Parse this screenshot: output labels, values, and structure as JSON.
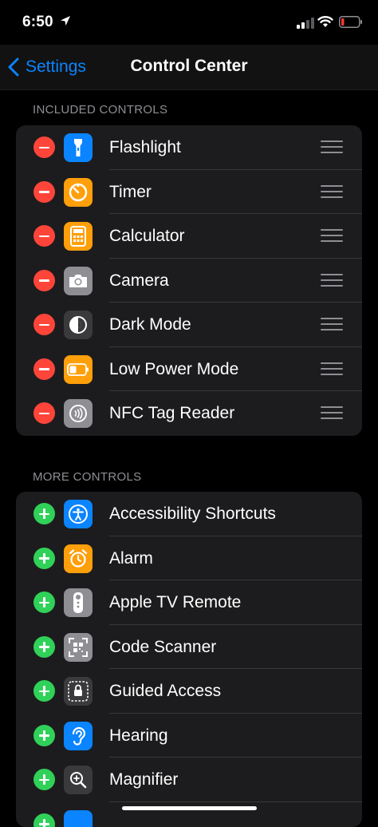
{
  "status_bar": {
    "time": "6:50",
    "battery_color": "#ff3b30"
  },
  "nav": {
    "back_label": "Settings",
    "title": "Control Center"
  },
  "colors": {
    "accent": "#0a84ff",
    "remove": "#ff453a",
    "add": "#30d158"
  },
  "included": {
    "header": "INCLUDED CONTROLS",
    "items": [
      {
        "label": "Flashlight",
        "icon": "flashlight-icon",
        "color": "#0a84ff"
      },
      {
        "label": "Timer",
        "icon": "timer-icon",
        "color": "#ff9f0a"
      },
      {
        "label": "Calculator",
        "icon": "calculator-icon",
        "color": "#ff9f0a"
      },
      {
        "label": "Camera",
        "icon": "camera-icon",
        "color": "#8e8e93"
      },
      {
        "label": "Dark Mode",
        "icon": "dark-mode-icon",
        "color": "#3a3a3c"
      },
      {
        "label": "Low Power Mode",
        "icon": "battery-icon",
        "color": "#ff9f0a"
      },
      {
        "label": "NFC Tag Reader",
        "icon": "nfc-icon",
        "color": "#8e8e93"
      }
    ]
  },
  "more": {
    "header": "MORE CONTROLS",
    "items": [
      {
        "label": "Accessibility Shortcuts",
        "icon": "accessibility-icon",
        "color": "#0a84ff"
      },
      {
        "label": "Alarm",
        "icon": "alarm-icon",
        "color": "#ff9f0a"
      },
      {
        "label": "Apple TV Remote",
        "icon": "tv-remote-icon",
        "color": "#8e8e93"
      },
      {
        "label": "Code Scanner",
        "icon": "qr-code-icon",
        "color": "#8e8e93"
      },
      {
        "label": "Guided Access",
        "icon": "lock-icon",
        "color": "#3a3a3c"
      },
      {
        "label": "Hearing",
        "icon": "ear-icon",
        "color": "#0a84ff"
      },
      {
        "label": "Magnifier",
        "icon": "magnifier-icon",
        "color": "#3a3a3c"
      },
      {
        "label": "",
        "icon": "partial-icon",
        "color": "#0a84ff"
      }
    ]
  }
}
